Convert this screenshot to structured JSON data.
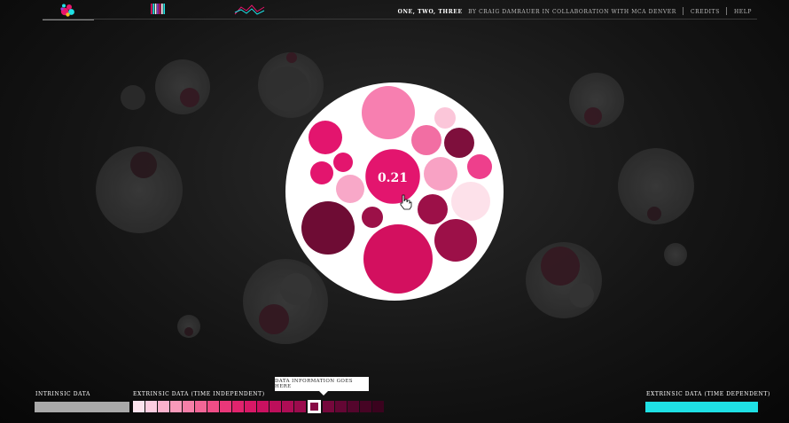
{
  "header": {
    "nav": [
      {
        "name": "bubbles-view-icon"
      },
      {
        "name": "bars-view-icon"
      },
      {
        "name": "line-view-icon"
      }
    ],
    "title": "One, Two, Three",
    "byline": "by Craig Damrauer in collaboration with MCA Denver",
    "credits_label": "Credits",
    "help_label": "Help"
  },
  "main": {
    "center_value": "0.21"
  },
  "legend": {
    "intrinsic_label": "Intrinsic Data",
    "extrinsic_independent_label": "Extrinsic Data (Time Independent)",
    "extrinsic_dependent_label": "Extrinsic Data (Time Dependent)",
    "tooltip": "Data information goes here",
    "intrinsic_color": "#a9a9a9",
    "extrinsic_dependent_color": "#1fe0e4",
    "swatch_colors": [
      "#fde4ee",
      "#fccde0",
      "#fbb2cd",
      "#f99aba",
      "#f67fa8",
      "#f26697",
      "#ee4d86",
      "#e93779",
      "#e1246d",
      "#d81866",
      "#ca1160",
      "#bd0f5b",
      "#ae0d55",
      "#9c0b4d",
      "#880944",
      "#76083c",
      "#640634",
      "#54052c",
      "#460424",
      "#3a031e"
    ],
    "selected_swatch_index": 14
  }
}
